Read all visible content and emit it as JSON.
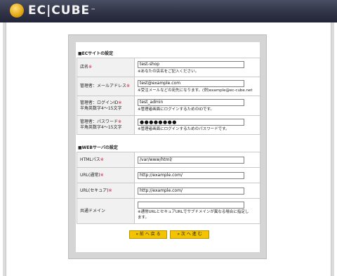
{
  "logo": {
    "text": "EC|CUBE",
    "tm": "™"
  },
  "section_ec": {
    "title": "■ECサイトの設定",
    "rows": [
      {
        "label": "店名",
        "required": "※",
        "value": "test-shop",
        "note": "※あなたの店名をご記入ください。"
      },
      {
        "label": "管理者：メールアドレス",
        "required": "※",
        "value": "test@example.com",
        "note": "※受注メールなどの宛先になります。(例)example@ec-cube.net"
      },
      {
        "label": "管理者：ログインID",
        "required": "※",
        "sub": "半角英数字4～15文字",
        "value": "test_admin",
        "note": "※管理者画面にログインするためのIDです。"
      },
      {
        "label": "管理者：パスワード",
        "required": "※",
        "sub": "半角英数字4～15文字",
        "value": "●●●●●●●●",
        "note": "※管理者画面にログインするためのパスワードです。"
      }
    ]
  },
  "section_web": {
    "title": "■WEBサーバの設定",
    "rows": [
      {
        "label": "HTMLパス",
        "required": "※",
        "value": "/var/www/html/"
      },
      {
        "label": "URL(通常)",
        "required": "※",
        "value": "http://example.com/"
      },
      {
        "label": "URL(セキュア)",
        "required": "※",
        "value": "http://example.com/"
      },
      {
        "label": "共通ドメイン",
        "required": "",
        "value": "",
        "note": "※通常URLとセキュアURLでサブドメインが異なる場合に指定します。"
      }
    ]
  },
  "buttons": {
    "back": "« 前 へ 戻 る",
    "next": "» 次 へ 進 む"
  },
  "colors": {
    "header": "#2f3244",
    "button": "#f5c400",
    "required": "#d4143a"
  }
}
